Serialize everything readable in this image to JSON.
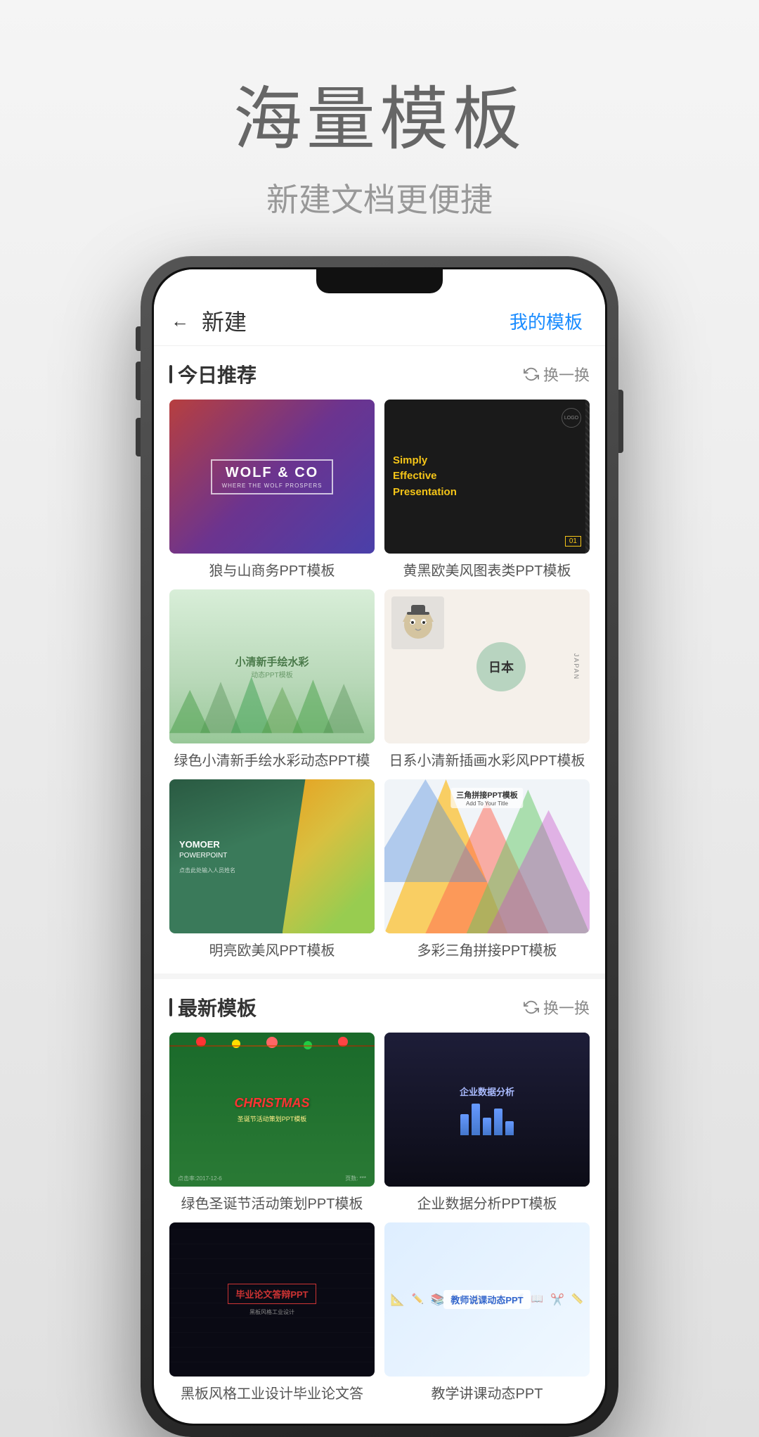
{
  "header": {
    "title": "海量模板",
    "subtitle": "新建文档更便捷"
  },
  "app": {
    "back_label": "←",
    "page_title": "新建",
    "my_templates_label": "我的模板",
    "section_today": "今日推荐",
    "section_latest": "最新模板",
    "refresh_label": "换一换",
    "templates_today": [
      {
        "id": "wolf",
        "name": "狼与山商务PPT模板",
        "brand": "WOLF & CO"
      },
      {
        "id": "simply",
        "name": "黄黑欧美风图表类PPT模板",
        "title_line1": "Simply",
        "title_line2": "Effective",
        "title_line3": "Presentation"
      },
      {
        "id": "watercolor",
        "name": "绿色小清新手绘水彩动态PPT模",
        "title": "小清新手绘水彩",
        "subtitle": "动态PPT模板"
      },
      {
        "id": "japan",
        "name": "日系小清新插画水彩风PPT模板",
        "char": "日本"
      },
      {
        "id": "yomoer",
        "name": "明亮欧美风PPT模板",
        "brand": "YOMOER",
        "subtitle": "POWERPOINT",
        "sub2": "点击此处输入人员姓名"
      },
      {
        "id": "triangle",
        "name": "多彩三角拼接PPT模板",
        "title": "三角拼接PPT模板",
        "subtitle": "Add To Your Title"
      }
    ],
    "templates_latest": [
      {
        "id": "christmas",
        "name": "绿色圣诞节活动策划PPT模板",
        "title": "CHRISTMAS",
        "subtitle": "圣诞节活动策划PPT模板"
      },
      {
        "id": "enterprise",
        "name": "企业数据分析PPT模板",
        "title": "企业数据分析"
      },
      {
        "id": "graduation",
        "name": "黑板风格工业设计毕业论文答",
        "title": "毕业论文答辩PPT"
      },
      {
        "id": "teacher",
        "name": "教学讲课动态PPT",
        "title": "教师说课动态PPT"
      }
    ]
  }
}
